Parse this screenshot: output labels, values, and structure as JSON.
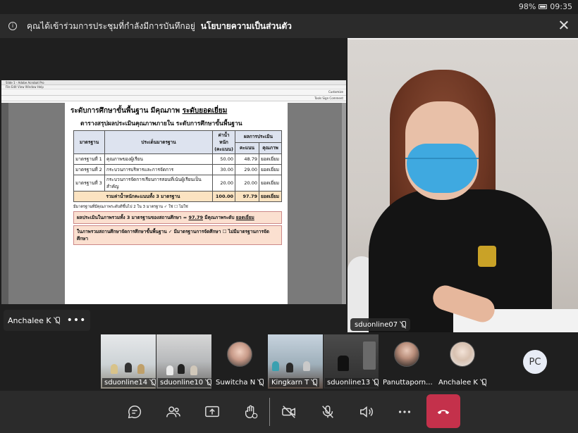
{
  "status_bar": {
    "battery": "98%",
    "time": "09:35"
  },
  "banner": {
    "message": "คุณได้เข้าร่วมการประชุมที่กำลังมีการบันทึกอยู่",
    "link": "นโยบายความเป็นส่วนตัว"
  },
  "shared_doc": {
    "app_title": "Slide 1 - Adobe Acrobat Pro",
    "menu": "File  Edit  View  Window  Help",
    "toolbar_right": "Customize",
    "tools_labels": "Tools   Sign   Comment",
    "heading": "ระดับการศึกษาขั้นพื้นฐาน มีคุณภาพ",
    "heading_level": "ระดับยอดเยี่ยม",
    "subheading": "ตารางสรุปผลประเมินคุณภาพภายใน ระดับการศึกษาขั้นพื้นฐาน",
    "table": {
      "headers": {
        "standard": "มาตรฐาน",
        "issue": "ประเด็นมาตรฐาน",
        "weight": "ค่าน้ำหนัก",
        "weight_unit": "(คะแนน)",
        "result": "ผลการประเมิน",
        "score": "คะแนน",
        "quality": "คุณภาพ"
      },
      "rows": [
        {
          "standard": "มาตรฐานที่ 1",
          "issue": "คุณภาพของผู้เรียน",
          "weight": "50.00",
          "score": "48.79",
          "quality": "ยอดเยี่ยม"
        },
        {
          "standard": "มาตรฐานที่ 2",
          "issue": "กระบวนการบริหารและการจัดการ",
          "weight": "30.00",
          "score": "29.00",
          "quality": "ยอดเยี่ยม"
        },
        {
          "standard": "มาตรฐานที่ 3",
          "issue": "กระบวนการจัดการเรียนการสอนที่เน้นผู้เรียนเป็นสำคัญ",
          "weight": "20.00",
          "score": "20.00",
          "quality": "ยอดเยี่ยม"
        }
      ],
      "total": {
        "label": "รวมค่าน้ำหนักคะแนนทั้ง 3 มาตรฐาน",
        "weight": "100.00",
        "score": "97.79",
        "quality": "ยอดเยี่ยม"
      }
    },
    "note1": "มีมาตรฐานที่มีคุณภาพระดับดีขึ้นไป 2 ใน 3 มาตรฐาน ✓ ใช่ ☐ ไม่ใช่",
    "note2_prefix": "ผลประเมินในภาพรวมทั้ง 3 มาตรฐานของสถานศึกษา =",
    "note2_score": "97.79",
    "note2_mid": "มีคุณภาพระดับ",
    "note2_level": "ยอดเยี่ยม",
    "note3": "ในภาพรวมสถานศึกษาจัดการศึกษาขั้นพื้นฐาน ✓ มีมาตรฐานการจัดศึกษา ☐ ไม่มีมาตรฐานการจัดศึกษา"
  },
  "presenter": {
    "name": "Anchalee K"
  },
  "main_speaker": {
    "name": "sduonline07"
  },
  "participants": [
    {
      "name": "sduonline14"
    },
    {
      "name": "sduonline10"
    },
    {
      "name": "Suwitcha N"
    },
    {
      "name": "Kingkarn T"
    },
    {
      "name": "sduonline13"
    },
    {
      "name": "Panuttaporn..."
    },
    {
      "name": "Anchalee K"
    },
    {
      "initials": "PC"
    }
  ],
  "colors": {
    "hangup": "#c4314b",
    "mask": "#3fa9e0"
  }
}
